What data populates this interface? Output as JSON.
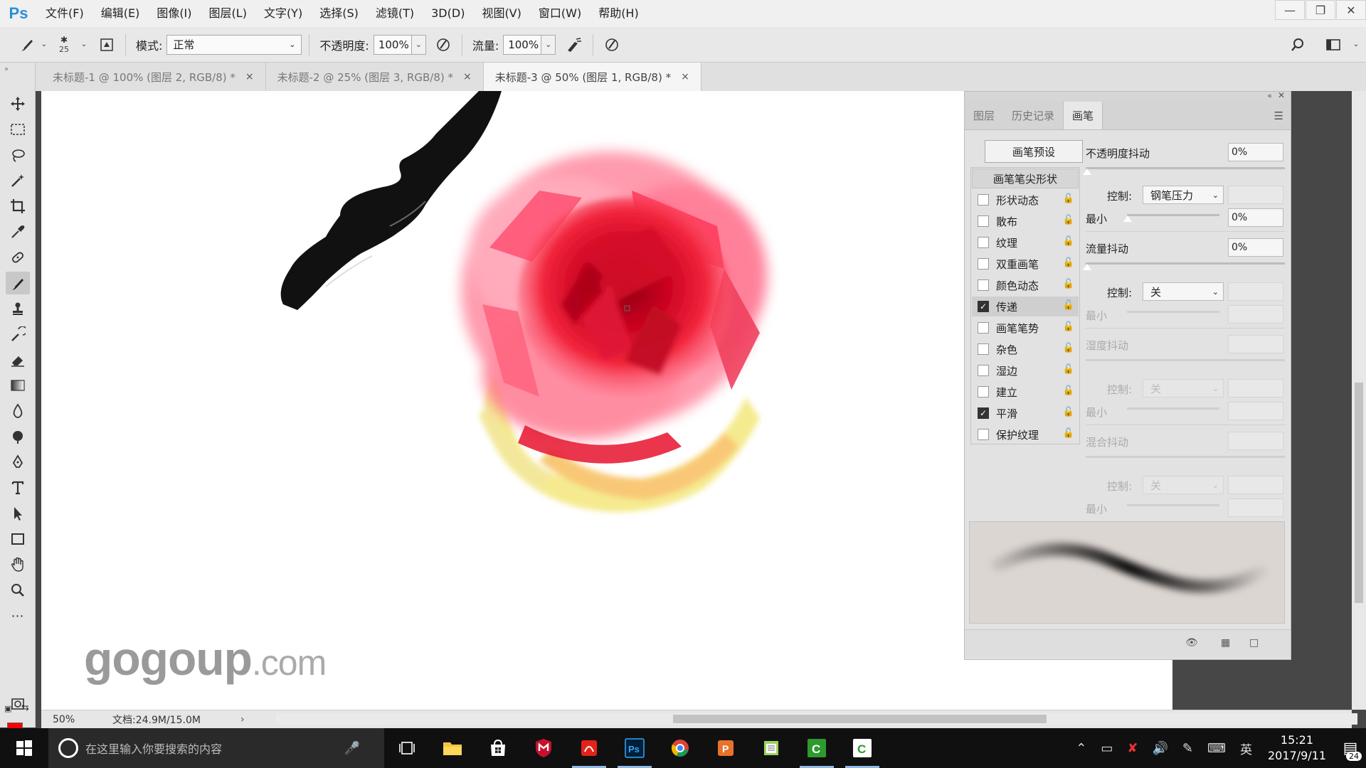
{
  "app": {
    "logo": "Ps"
  },
  "menu": [
    "文件(F)",
    "编辑(E)",
    "图像(I)",
    "图层(L)",
    "文字(Y)",
    "选择(S)",
    "滤镜(T)",
    "3D(D)",
    "视图(V)",
    "窗口(W)",
    "帮助(H)"
  ],
  "options": {
    "brush_size": "25",
    "mode_label": "模式:",
    "mode_value": "正常",
    "opacity_label": "不透明度:",
    "opacity_value": "100%",
    "flow_label": "流量:",
    "flow_value": "100%"
  },
  "tabs": [
    {
      "label": "未标题-1 @ 100% (图层 2, RGB/8) *",
      "close": "×"
    },
    {
      "label": "未标题-2 @ 25% (图层 3, RGB/8) *",
      "close": "×"
    },
    {
      "label": "未标题-3 @ 50% (图层 1, RGB/8) *",
      "close": "×"
    }
  ],
  "canvas": {
    "watermark_main": "gogoup",
    "watermark_suffix": ".com"
  },
  "panel": {
    "tabs": [
      "图层",
      "历史记录",
      "画笔"
    ],
    "preset_button": "画笔预设",
    "tip_shape": "画笔笔尖形状",
    "options": [
      {
        "label": "形状动态",
        "checked": false
      },
      {
        "label": "散布",
        "checked": false
      },
      {
        "label": "纹理",
        "checked": false
      },
      {
        "label": "双重画笔",
        "checked": false
      },
      {
        "label": "颜色动态",
        "checked": false
      },
      {
        "label": "传递",
        "checked": true
      },
      {
        "label": "画笔笔势",
        "checked": false
      },
      {
        "label": "杂色",
        "checked": false
      },
      {
        "label": "湿边",
        "checked": false
      },
      {
        "label": "建立",
        "checked": false
      },
      {
        "label": "平滑",
        "checked": true
      },
      {
        "label": "保护纹理",
        "checked": false
      }
    ],
    "transfer": {
      "opacity_jitter_label": "不透明度抖动",
      "opacity_jitter_value": "0%",
      "control_label": "控制:",
      "control_value_1": "钢笔压力",
      "min_label": "最小",
      "min_value_1": "0%",
      "flow_jitter_label": "流量抖动",
      "flow_jitter_value": "0%",
      "control_value_2": "关",
      "wetness_label": "湿度抖动",
      "control_value_3": "关",
      "mix_label": "混合抖动",
      "control_value_4": "关"
    }
  },
  "status": {
    "zoom": "50%",
    "doc": "文档:24.9M/15.0M",
    "arrow": "›"
  },
  "taskbar": {
    "search_placeholder": "在这里输入你要搜索的内容",
    "ime": "英",
    "time": "15:21",
    "date": "2017/9/11",
    "notifications": "24"
  },
  "colors": {
    "foreground": "#ff0000",
    "background": "#ffffff",
    "accent": "#2a8fd8"
  }
}
